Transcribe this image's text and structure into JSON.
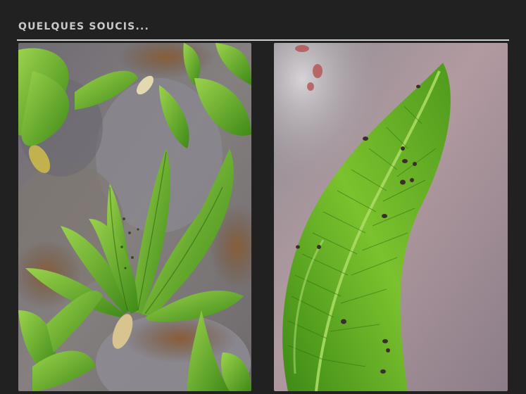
{
  "slide": {
    "title": "QUELQUES SOUCIS..."
  },
  "colors": {
    "background": "#212121",
    "title_text": "#c9c9c9",
    "rule": "#cfcfcf",
    "leaf_green": "#5aa321",
    "leaf_highlight": "#9ad04a",
    "rock_grey": "#7d7a80",
    "soil_brown": "#7a5a3e",
    "felt_pink": "#a98f98"
  },
  "images": [
    {
      "name": "fern-plant-photo",
      "icon": "fern-clump-on-rock"
    },
    {
      "name": "spotted-frond-photo",
      "icon": "fern-frond-with-insect-spots"
    }
  ]
}
